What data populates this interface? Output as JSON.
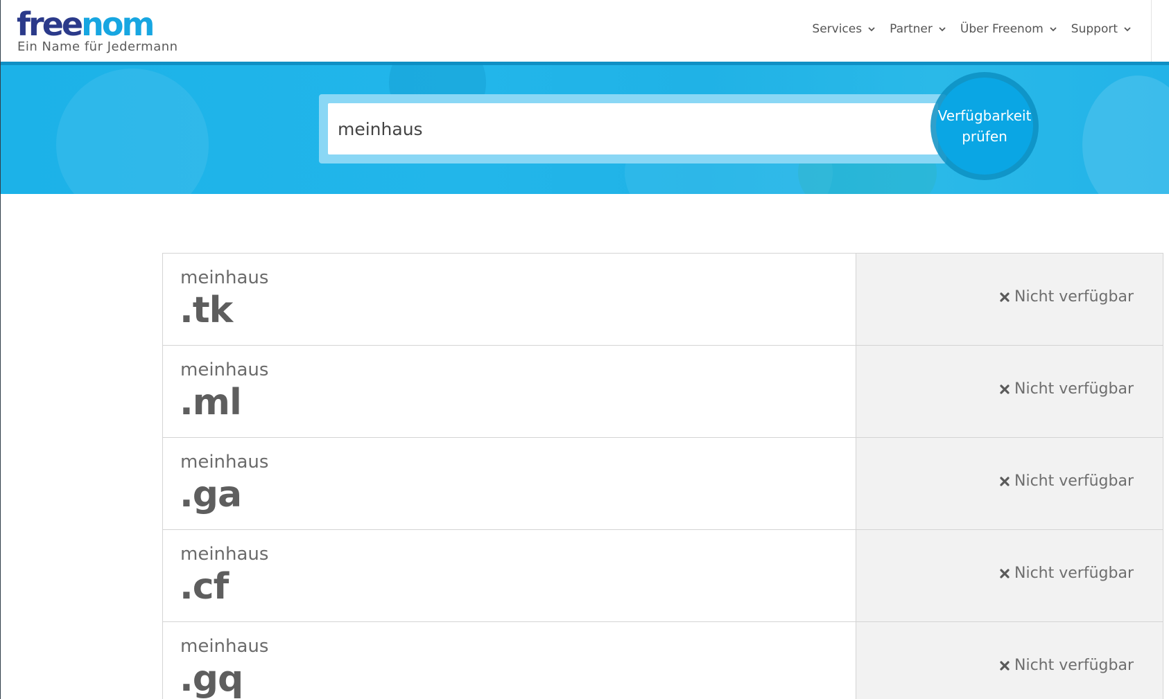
{
  "header": {
    "logo_free": "free",
    "logo_nom": "nom",
    "tagline": "Ein Name für Jedermann",
    "nav": [
      {
        "label": "Services"
      },
      {
        "label": "Partner"
      },
      {
        "label": "Über Freenom"
      },
      {
        "label": "Support"
      }
    ]
  },
  "search": {
    "value": "meinhaus",
    "button_line1": "Verfügbarkeit",
    "button_line2": "prüfen"
  },
  "results": [
    {
      "name": "meinhaus",
      "tld": ".tk",
      "status": "Nicht verfügbar"
    },
    {
      "name": "meinhaus",
      "tld": ".ml",
      "status": "Nicht verfügbar"
    },
    {
      "name": "meinhaus",
      "tld": ".ga",
      "status": "Nicht verfügbar"
    },
    {
      "name": "meinhaus",
      "tld": ".cf",
      "status": "Nicht verfügbar"
    },
    {
      "name": "meinhaus",
      "tld": ".gq",
      "status": "Nicht verfügbar"
    }
  ],
  "colors": {
    "brand_dark": "#2b3a8a",
    "brand_light": "#17a6e1",
    "banner": "#1fb3e8",
    "button": "#0aa6e4"
  }
}
